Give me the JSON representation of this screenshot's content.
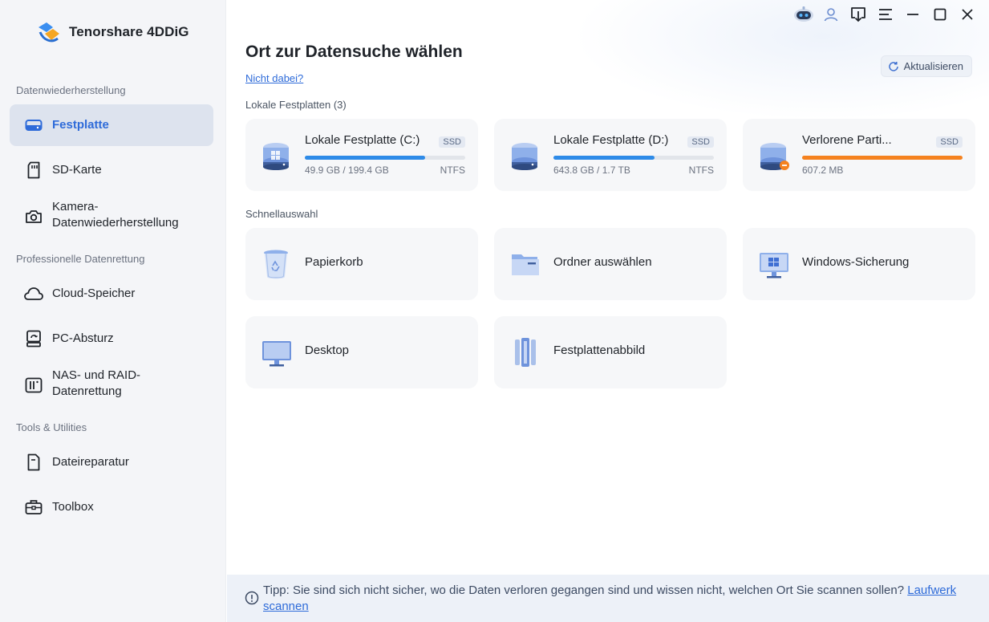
{
  "app": {
    "name": "Tenorshare 4DDiG",
    "accent": "#2e6bd9"
  },
  "sidebar": {
    "sections": [
      {
        "title": "Datenwiederherstellung"
      },
      {
        "title": "Professionelle Datenrettung"
      },
      {
        "title": "Tools & Utilities"
      }
    ],
    "items": [
      {
        "label": "Festplatte",
        "icon": "hard-drive-icon",
        "active": true
      },
      {
        "label": "SD-Karte",
        "icon": "sd-card-icon"
      },
      {
        "label": "Kamera-",
        "label2": "Datenwiederherstellung",
        "icon": "camera-icon"
      },
      {
        "label": "Cloud-Speicher",
        "icon": "cloud-icon"
      },
      {
        "label": "PC-Absturz",
        "icon": "pc-crash-icon"
      },
      {
        "label": "NAS- und RAID-",
        "label2": "Datenrettung",
        "icon": "nas-icon"
      },
      {
        "label": "Dateireparatur",
        "icon": "file-repair-icon"
      },
      {
        "label": "Toolbox",
        "icon": "toolbox-icon"
      }
    ]
  },
  "main": {
    "title": "Ort zur Datensuche wählen",
    "help_link": "Nicht dabei?",
    "refresh_label": "Aktualisieren",
    "drives_title": "Lokale Festplatten (3)",
    "drives": [
      {
        "name": "Lokale Festplatte (C:)",
        "badge": "SSD",
        "size": "49.9 GB / 199.4 GB",
        "fs": "NTFS",
        "usage": 0.75,
        "color": "#2e8be8"
      },
      {
        "name": "Lokale Festplatte (D:)",
        "badge": "SSD",
        "size": "643.8 GB / 1.7 TB",
        "fs": "NTFS",
        "usage": 0.63,
        "color": "#2e8be8"
      },
      {
        "name": "Verlorene Parti...",
        "badge": "SSD",
        "size": "607.2 MB",
        "fs": "",
        "usage": 1.0,
        "color": "#f5821f"
      }
    ],
    "quick_title": "Schnellauswahl",
    "quick": [
      {
        "label": "Papierkorb",
        "icon": "recycle-bin-icon"
      },
      {
        "label": "Ordner auswählen",
        "icon": "folder-icon"
      },
      {
        "label": "Windows-Sicherung",
        "icon": "windows-backup-icon"
      },
      {
        "label": "Desktop",
        "icon": "desktop-icon"
      },
      {
        "label": "Festplattenabbild",
        "icon": "disk-image-icon"
      }
    ],
    "tip_text": "Tipp: Sie sind sich nicht sicher, wo die Daten verloren gegangen sind und wissen nicht, welchen Ort Sie scannen sollen?",
    "tip_link": "Laufwerk scannen"
  },
  "topbar": [
    "robot-assistant-icon",
    "user-icon",
    "download-icon",
    "menu-icon",
    "minimize-icon",
    "maximize-icon",
    "close-icon"
  ]
}
